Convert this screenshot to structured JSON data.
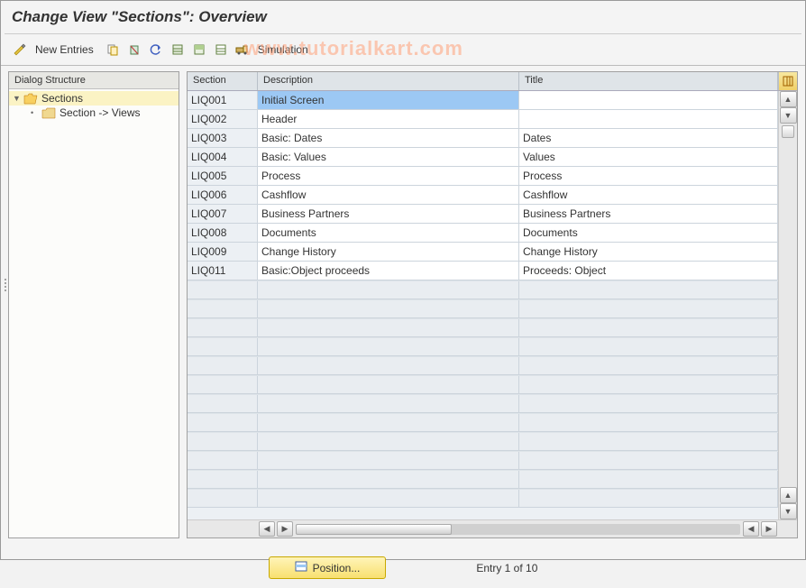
{
  "title": "Change View \"Sections\": Overview",
  "watermark": "www.tutorialkart.com",
  "toolbar": {
    "new_entries": "New Entries",
    "simulation": "Simulation"
  },
  "tree": {
    "header": "Dialog Structure",
    "root": "Sections",
    "child": "Section -> Views"
  },
  "grid": {
    "cols": {
      "section": "Section",
      "description": "Description",
      "title": "Title"
    },
    "rows": [
      {
        "section": "LIQ001",
        "description": "Initial Screen",
        "title": ""
      },
      {
        "section": "LIQ002",
        "description": "Header",
        "title": ""
      },
      {
        "section": "LIQ003",
        "description": "Basic: Dates",
        "title": "Dates"
      },
      {
        "section": "LIQ004",
        "description": "Basic: Values",
        "title": "Values"
      },
      {
        "section": "LIQ005",
        "description": "Process",
        "title": "Process"
      },
      {
        "section": "LIQ006",
        "description": "Cashflow",
        "title": "Cashflow"
      },
      {
        "section": "LIQ007",
        "description": "Business Partners",
        "title": "Business Partners"
      },
      {
        "section": "LIQ008",
        "description": "Documents",
        "title": "Documents"
      },
      {
        "section": "LIQ009",
        "description": "Change History",
        "title": "Change History"
      },
      {
        "section": "LIQ011",
        "description": "Basic:Object proceeds",
        "title": "Proceeds: Object"
      }
    ],
    "selected_row": 0,
    "empty_rows": 12
  },
  "footer": {
    "position_label": "Position...",
    "status": "Entry 1 of 10"
  }
}
